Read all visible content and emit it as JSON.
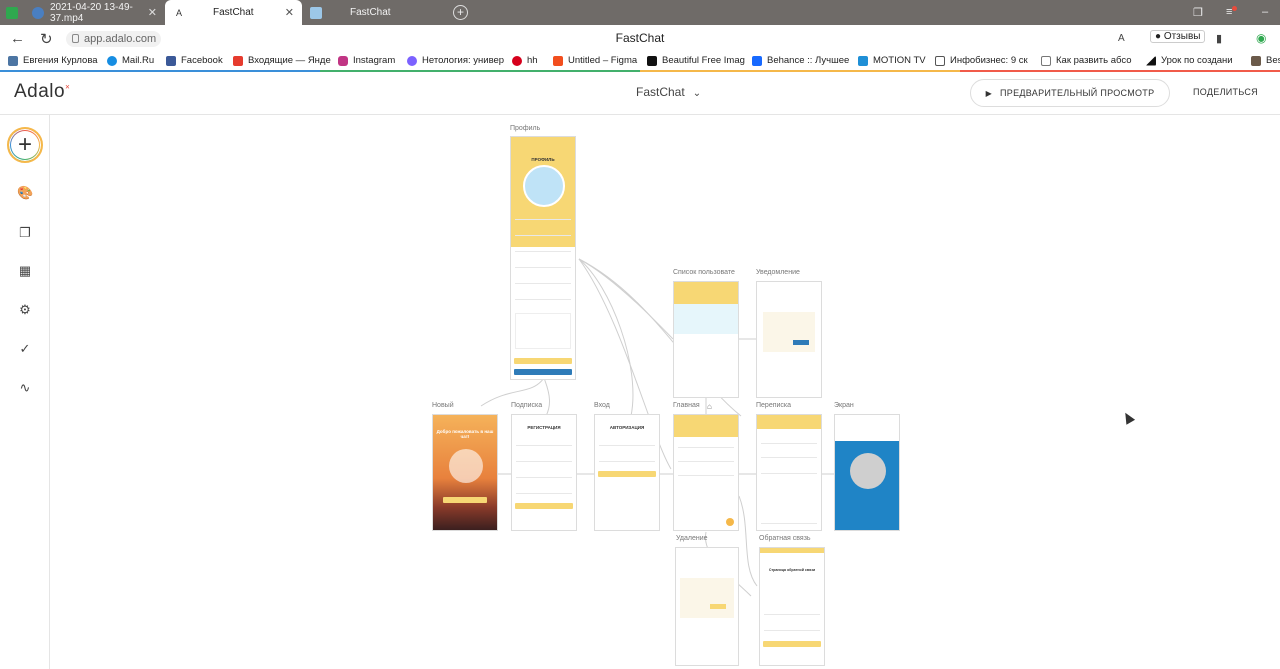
{
  "browser": {
    "tabs": [
      {
        "label": "2021-04-20 13-49-37.mp4"
      },
      {
        "label": "FastChat"
      },
      {
        "label": "FastChat"
      }
    ],
    "url": "app.adalo.com",
    "page_title": "FastChat",
    "reviews": "Отзывы"
  },
  "bookmarks": [
    "Евгения Курлова",
    "Mail.Ru",
    "Facebook",
    "Входящие — Янде",
    "Instagram",
    "Нетология: универ",
    "hh",
    "Untitled – Figma",
    "Beautiful Free Imag",
    "Behance :: Лучшее",
    "MOTION TV",
    "Инфобизнес: 9 ск",
    "Как развить абсо",
    "Урок по создани",
    "Bes"
  ],
  "app": {
    "logo": "Adalo",
    "name": "FastChat",
    "preview_label": "ПРЕДВАРИТЕЛЬНЫЙ ПРОСМОТР",
    "share_label": "ПОДЕЛИТЬСЯ"
  },
  "screens": {
    "profile": {
      "label": "Профиль",
      "title": "ПРОФИЛЬ"
    },
    "users": {
      "label": "Список пользовате"
    },
    "notify": {
      "label": "Уведомление"
    },
    "newuser": {
      "label": "Новый",
      "welcome": "Добро пожаловать в наш чат!"
    },
    "signup": {
      "label": "Подписка",
      "title": "РЕГИСТРАЦИЯ"
    },
    "login": {
      "label": "Вход",
      "title": "АВТОРИЗАЦИЯ"
    },
    "main": {
      "label": "Главная"
    },
    "chat": {
      "label": "Переписка"
    },
    "screen": {
      "label": "Экран"
    },
    "delete": {
      "label": "Удаление"
    },
    "feedback": {
      "label": "Обратная связь",
      "title": "Страница обратной связи"
    }
  },
  "colors": {
    "screen_yellow": "#f7d774",
    "screen_blue": "#1f84c6",
    "accent_red": "#e84b3c"
  }
}
